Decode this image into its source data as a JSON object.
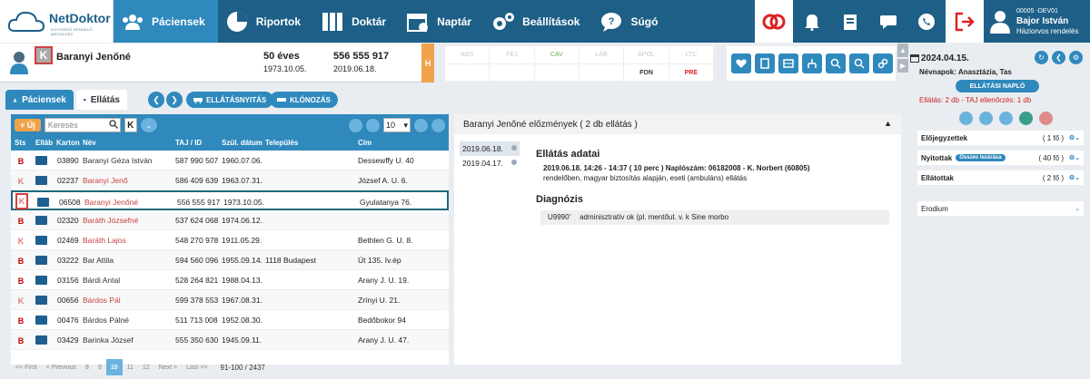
{
  "app": {
    "logo_name": "NetDoktor",
    "logo_tagline": "EGYSZERŰ RENDELŐ MEGOLDÁS"
  },
  "nav": {
    "items": [
      {
        "label": "Páciensek",
        "icon": "patients-icon",
        "active": true
      },
      {
        "label": "Riportok",
        "icon": "chart-icon",
        "active": false
      },
      {
        "label": "Doktár",
        "icon": "binders-icon",
        "active": false
      },
      {
        "label": "Naptár",
        "icon": "calendar-icon",
        "active": false
      },
      {
        "label": "Beállítások",
        "icon": "gears-icon",
        "active": false
      },
      {
        "label": "Súgó",
        "icon": "help-icon",
        "active": false
      }
    ]
  },
  "user": {
    "code": "00005 -DEV01",
    "name": "Bajor István",
    "role": "Háziorvos rendelés"
  },
  "patient": {
    "badge": "K",
    "name": "Baranyi Jenőné",
    "age": "50 éves",
    "birth": "1973.10.05.",
    "taj": "556 555 917",
    "last_visit": "2019.06.18.",
    "h_label": "H"
  },
  "labs": [
    "ABS",
    "FEJ",
    "CAV",
    "LÁB",
    "ÁPOL",
    "LTC",
    "",
    "",
    "",
    "",
    "FON",
    "PRE"
  ],
  "tabs": {
    "patients": "Páciensek",
    "care": "Ellátás",
    "open_care": "ELLÁTÁSNYITÁS",
    "clone": "KLÓNOZÁS"
  },
  "list": {
    "new_label": "+ Új",
    "search_placeholder": "Keresés",
    "filter_k": "K",
    "page_size": "10",
    "columns": {
      "sts": "Sts",
      "ellat": "Elláb",
      "karton": "Karton",
      "nev": "Név",
      "taj": "TAJ / ID",
      "szul": "Szül. dátum",
      "telep": "Település",
      "cim": "Cím"
    },
    "rows": [
      {
        "sts": "B",
        "karton": "03890",
        "nev": "Baranyi Géza István",
        "taj": "587 990 507",
        "szul": "1960.07.06.",
        "telep": "",
        "cim": "Dessewffy U. 40",
        "red": false
      },
      {
        "sts": "K",
        "karton": "02237",
        "nev": "Baranyi Jenő",
        "taj": "586 409 639",
        "szul": "1963.07.31.",
        "telep": "",
        "cim": "József A. U. 6.",
        "red": true
      },
      {
        "sts": "K",
        "karton": "06508",
        "nev": "Baranyi Jenőné",
        "taj": "556 555 917",
        "szul": "1973.10.05.",
        "telep": "",
        "cim": "Gyulatanya 76.",
        "red": true
      },
      {
        "sts": "B",
        "karton": "02320",
        "nev": "Baráth Józsefné",
        "taj": "537 624 068",
        "szul": "1974.06.12.",
        "telep": "",
        "cim": "",
        "red": true
      },
      {
        "sts": "K",
        "karton": "02469",
        "nev": "Baráth Lajos",
        "taj": "548 270 978",
        "szul": "1911.05.29.",
        "telep": "",
        "cim": "Bethlen G. U. 8.",
        "red": true
      },
      {
        "sts": "B",
        "karton": "03222",
        "nev": "Bar Attila",
        "taj": "594 560 096",
        "szul": "1955.09.14.",
        "telep": "1118 Budapest",
        "cim": "Út 135. Iv.ép",
        "red": false
      },
      {
        "sts": "B",
        "karton": "03156",
        "nev": "Bárdi Antal",
        "taj": "528 264 821",
        "szul": "1988.04.13.",
        "telep": "",
        "cim": "Arany J. U. 19.",
        "red": false
      },
      {
        "sts": "K",
        "karton": "00656",
        "nev": "Bárdos Pál",
        "taj": "599 378 553",
        "szul": "1967.08.31.",
        "telep": "",
        "cim": "Zrínyi U. 21.",
        "red": true
      },
      {
        "sts": "B",
        "karton": "00476",
        "nev": "Bárdos Pálné",
        "taj": "511 713 008",
        "szul": "1952.08.30.",
        "telep": "",
        "cim": "Bedőbokor 94",
        "red": false
      },
      {
        "sts": "B",
        "karton": "03429",
        "nev": "Barinka József",
        "taj": "555 350 630",
        "szul": "1945.09.11.",
        "telep": "",
        "cim": "Arany J. U. 47.",
        "red": false
      }
    ],
    "pager": {
      "first": "<< First",
      "prev": "< Previous",
      "p8": "8",
      "p9": "9",
      "p10": "10",
      "p11": "11",
      "p12": "12",
      "next": "Next >",
      "last": "Last >>",
      "total": "91-100 / 2437"
    }
  },
  "history": {
    "title": "Baranyi Jenőné előzmények ( 2 db ellátás )",
    "dates": [
      "2019.06.18.",
      "2019.04.17."
    ],
    "section1": "Ellátás adatai",
    "line1": "2019.06.18. 14:26 - 14:37 ( 10 perc ) Naplószám: 06182008 - K. Norbert (60805)",
    "line2": "rendelőben, magyar biztosítás alapján, eseti (ambuláns) ellátás",
    "section2": "Diagnózis",
    "diag_code": "U9990'",
    "diag_text": "adminisztratív ok (pl. mentőut. v. k   Sine morbo"
  },
  "sidebar": {
    "date": "2024.04.15.",
    "nevnapok": "Névnapok: Anasztázia, Tas",
    "napl_btn": "ELLÁTÁSI NAPLÓ",
    "stats": "Ellátás: 2 db - TAJ ellenőrzés: 1 db",
    "boxes": [
      {
        "label": "Előjegyzettek",
        "count": "( 1 fő )",
        "badge": ""
      },
      {
        "label": "Nyitottak",
        "count": "( 40 fő )",
        "badge": "Összes lezárása"
      },
      {
        "label": "Ellátottak",
        "count": "( 2 fő )",
        "badge": ""
      },
      {
        "label": "Erodium",
        "count": "",
        "badge": ""
      }
    ]
  }
}
